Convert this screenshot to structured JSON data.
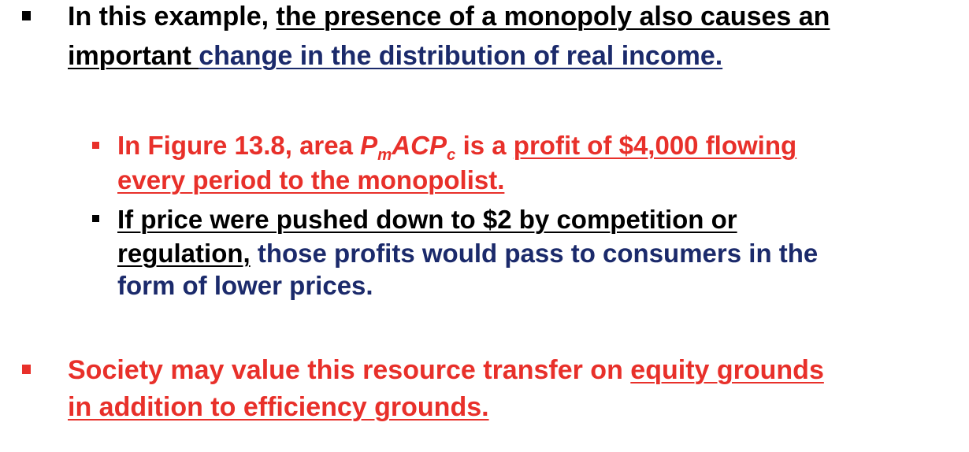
{
  "colors": {
    "text_black": "#000000",
    "text_blue": "#1b2a6b",
    "accent_red": "#e8302a"
  },
  "bullets": [
    {
      "level": 1,
      "marker": "square-black",
      "line1": {
        "p1": "In this example, ",
        "p2": "the presence of a monopoly also causes an"
      },
      "line2": {
        "p1": "important ",
        "p2": "change in the distribution of real income."
      }
    },
    {
      "level": 2,
      "marker": "square-red",
      "line1": {
        "p1": "In Figure 13.8, area ",
        "P1": "P",
        "m": "m",
        "ACP": "ACP",
        "c": "c",
        "p2": " is a ",
        "p3": "profit of $4,000 flowing"
      },
      "line2": {
        "p1": "every period to the monopolist."
      }
    },
    {
      "level": 2,
      "marker": "square-black",
      "line1": {
        "p1": "If price were pushed down to $2 by competition or"
      },
      "line2": {
        "p1": "regulation,",
        "p2": " those profits would pass to consumers in the"
      },
      "line3": {
        "p1": "form of lower prices."
      }
    },
    {
      "level": 1,
      "marker": "square-red",
      "line1": {
        "p1": "Society may value this resource transfer on ",
        "p2": "equity grounds"
      },
      "line2": {
        "p1": "in addition to efficiency grounds."
      }
    }
  ]
}
